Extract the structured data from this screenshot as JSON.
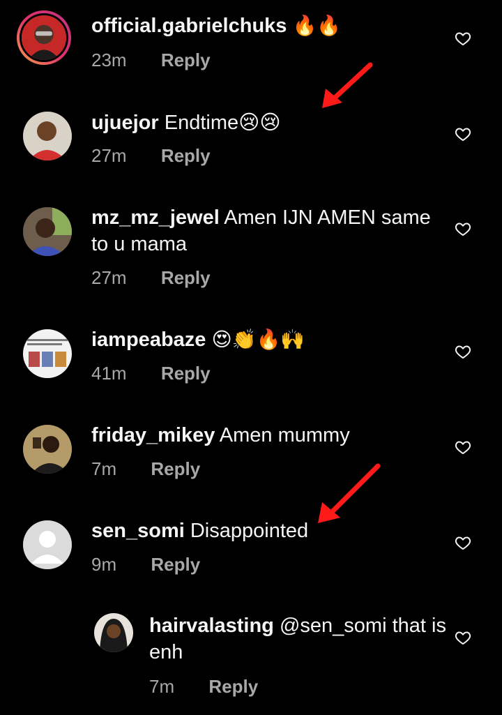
{
  "comments": [
    {
      "username": "official.gabrielchuks",
      "text": "🔥🔥",
      "time": "23m",
      "reply": "Reply"
    },
    {
      "username": "ujuejor",
      "text": "Endtime😢😢",
      "time": "27m",
      "reply": "Reply"
    },
    {
      "username": "mz_mz_jewel",
      "text": "Amen IJN AMEN same to u mama",
      "time": "27m",
      "reply": "Reply"
    },
    {
      "username": "iampeabaze",
      "text": "😍👏🔥🙌",
      "time": "41m",
      "reply": "Reply"
    },
    {
      "username": "friday_mikey",
      "text": "Amen mummy",
      "time": "7m",
      "reply": "Reply"
    },
    {
      "username": "sen_somi",
      "text": "Disappointed",
      "time": "9m",
      "reply": "Reply"
    }
  ],
  "reply_thread": {
    "username": "hairvalasting",
    "mention": "@sen_somi",
    "text": "that is enh",
    "time": "7m",
    "reply": "Reply"
  },
  "icons": {
    "like": "heart-outline-icon",
    "annotation": "red-arrow"
  },
  "colors": {
    "background": "#000000",
    "text": "#f5f5f5",
    "meta": "#a8a8a8",
    "arrow": "#ff1a1a"
  }
}
